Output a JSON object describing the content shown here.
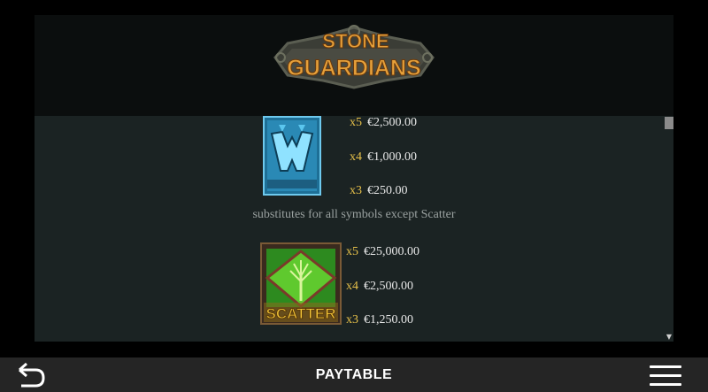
{
  "game": {
    "logo_line1": "STONE",
    "logo_line2": "GUARDIANS"
  },
  "paytable": {
    "symbols": [
      {
        "icon": "wild-w-icon",
        "payouts": [
          {
            "mult": "x5",
            "amount": "€2,500.00"
          },
          {
            "mult": "x4",
            "amount": "€1,000.00"
          },
          {
            "mult": "x3",
            "amount": "€250.00"
          }
        ],
        "description": "substitutes for all symbols except Scatter"
      },
      {
        "icon": "scatter-tree-icon",
        "label": "SCATTER",
        "payouts": [
          {
            "mult": "x5",
            "amount": "€25,000.00"
          },
          {
            "mult": "x4",
            "amount": "€2,500.00"
          },
          {
            "mult": "x3",
            "amount": "€1,250.00"
          }
        ]
      }
    ]
  },
  "bottom_bar": {
    "title": "PAYTABLE",
    "back_icon": "back-arrow-icon",
    "menu_icon": "hamburger-menu-icon"
  },
  "colors": {
    "multiplier": "#e7c14a",
    "amount": "#e7e7e7",
    "description": "#9aa1a0",
    "panel": "#1b2323"
  }
}
